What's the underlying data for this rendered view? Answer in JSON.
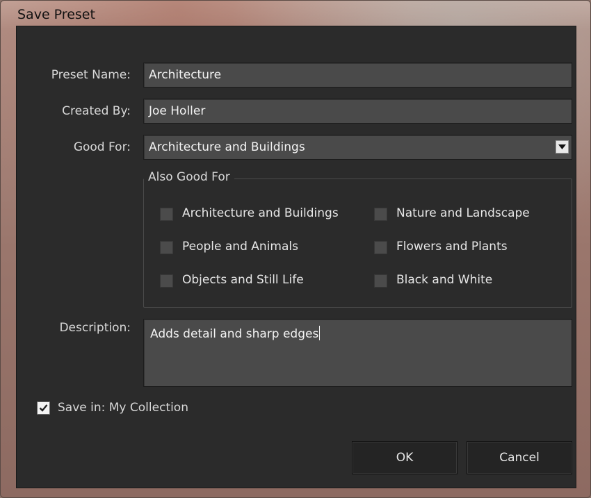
{
  "window": {
    "title": "Save Preset"
  },
  "form": {
    "preset_name_label": "Preset Name:",
    "preset_name_value": "Architecture",
    "created_by_label": "Created By:",
    "created_by_value": "Joe Holler",
    "good_for_label": "Good For:",
    "good_for_value": "Architecture and Buildings",
    "description_label": "Description:",
    "description_value": "Adds detail and sharp edges"
  },
  "also_good_for": {
    "legend": "Also Good For",
    "options": [
      {
        "label": "Architecture and Buildings",
        "checked": false
      },
      {
        "label": "Nature and Landscape",
        "checked": false
      },
      {
        "label": "People and Animals",
        "checked": false
      },
      {
        "label": "Flowers and Plants",
        "checked": false
      },
      {
        "label": "Objects and Still Life",
        "checked": false
      },
      {
        "label": "Black and White",
        "checked": false
      }
    ]
  },
  "save_in": {
    "label": "Save in: My Collection",
    "checked": true
  },
  "buttons": {
    "ok": "OK",
    "cancel": "Cancel"
  },
  "icons": {
    "dropdown": "chevron-down-icon",
    "check": "check-icon"
  }
}
